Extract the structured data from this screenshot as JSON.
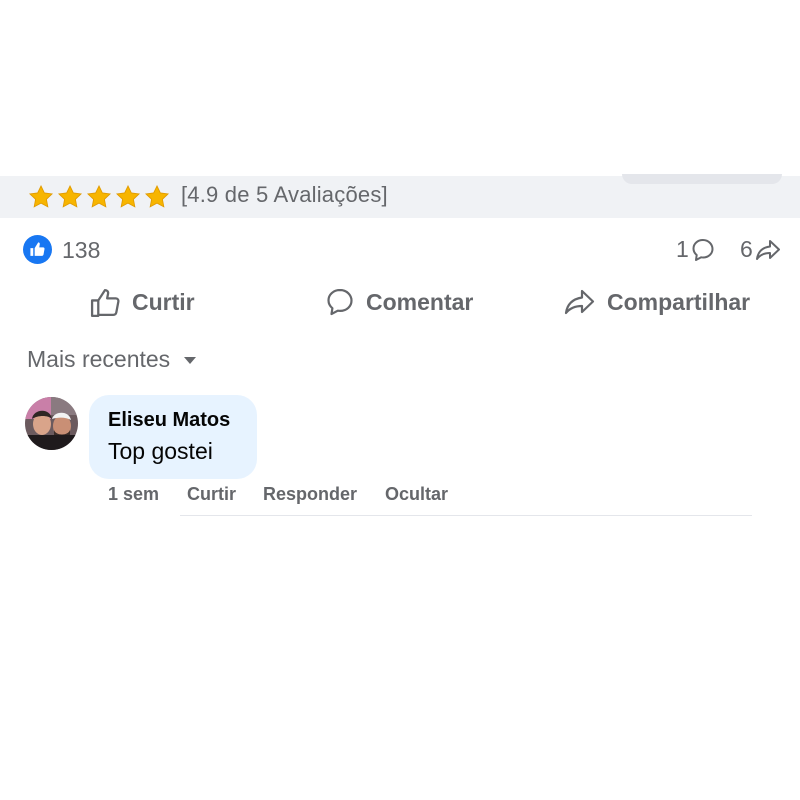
{
  "rating": {
    "stars": 5,
    "text": "[4.9 de 5 Avaliações]",
    "star_color": "#f7b500"
  },
  "reactions": {
    "likes": "138",
    "comments": "1",
    "shares": "6",
    "like_color": "#1877f2"
  },
  "actions": {
    "like": "Curtir",
    "comment": "Comentar",
    "share": "Compartilhar"
  },
  "sort": {
    "label": "Mais recentes"
  },
  "comment": {
    "author": "Eliseu Matos",
    "text": "Top gostei",
    "bubble_color": "#e7f3ff",
    "time": "1 sem",
    "like": "Curtir",
    "reply": "Responder",
    "hide": "Ocultar"
  }
}
